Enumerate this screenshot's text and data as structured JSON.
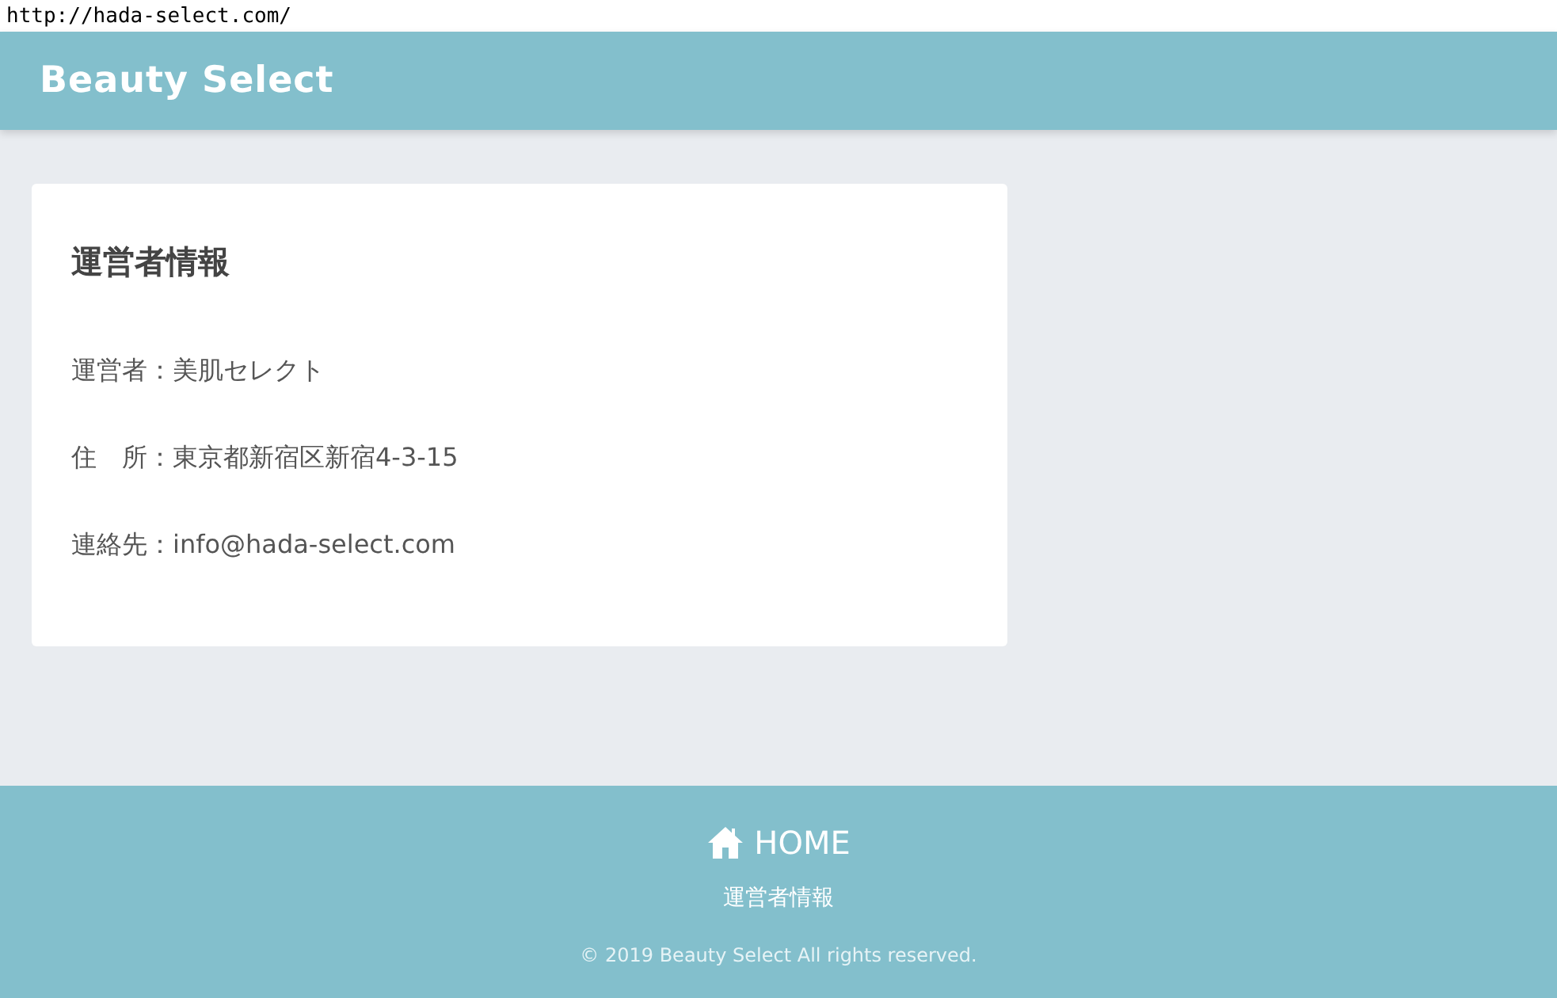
{
  "address_bar": {
    "url": "http://hada-select.com/"
  },
  "header": {
    "site_title": "Beauty Select"
  },
  "card": {
    "title": "運営者情報",
    "rows": [
      {
        "text": "運営者：美肌セレクト"
      },
      {
        "text": "住　所：東京都新宿区新宿4-3-15"
      },
      {
        "text": "連絡先：info@hada-select.com"
      }
    ]
  },
  "footer": {
    "home_link": "HOME",
    "links": [
      "運営者情報"
    ],
    "copyright": "© 2019 Beauty Select All rights reserved."
  }
}
